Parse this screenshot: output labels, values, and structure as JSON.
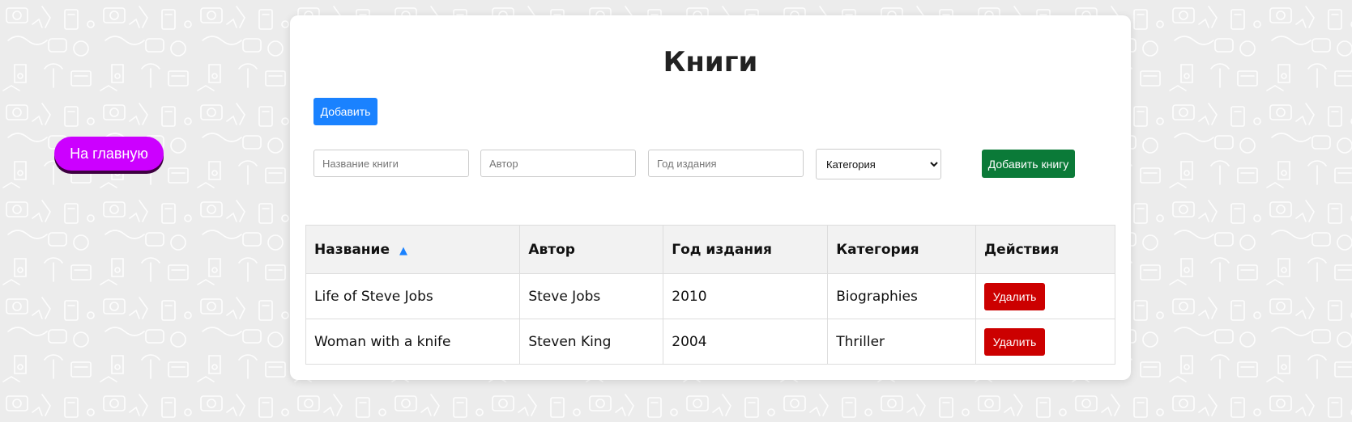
{
  "nav": {
    "home_label": "На главную"
  },
  "page": {
    "title": "Книги"
  },
  "toolbar": {
    "add_label": "Добавить"
  },
  "form": {
    "title_placeholder": "Название книги",
    "author_placeholder": "Автор",
    "year_placeholder": "Год издания",
    "category_selected": "Категория",
    "submit_label": "Добавить книгу"
  },
  "table": {
    "headers": [
      "Название",
      "Автор",
      "Год издания",
      "Категория",
      "Действия"
    ],
    "sort_indicator": "▲",
    "rows": [
      {
        "title": "Life of Steve Jobs",
        "author": "Steve Jobs",
        "year": "2010",
        "category": "Biographies",
        "action": "Удалить"
      },
      {
        "title": "Woman with a knife",
        "author": "Steven King",
        "year": "2004",
        "category": "Thriller",
        "action": "Удалить"
      }
    ]
  },
  "colors": {
    "home_button": "#cc00ff",
    "add_button": "#1a82ff",
    "submit_button": "#0b7a38",
    "delete_button": "#cc0000",
    "background": "#ececec"
  }
}
